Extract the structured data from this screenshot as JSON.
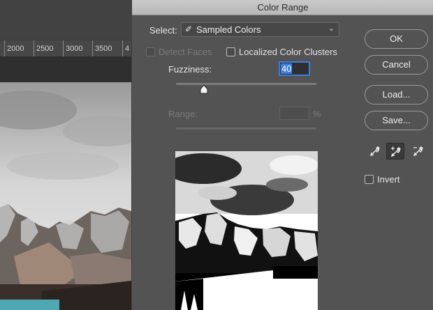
{
  "ruler": {
    "labels": [
      "2000",
      "2500",
      "3000",
      "3500",
      "4"
    ]
  },
  "dialog": {
    "title": "Color Range",
    "select_label": "Select:",
    "select_value": "Sampled Colors",
    "detect_faces_label": "Detect Faces",
    "localized_label": "Localized Color Clusters",
    "fuzziness_label": "Fuzziness:",
    "fuzziness_value": "40",
    "range_label": "Range:",
    "range_unit": "%",
    "fuzziness_level": 40,
    "buttons": {
      "ok": "OK",
      "cancel": "Cancel",
      "load": "Load...",
      "save": "Save..."
    },
    "invert_label": "Invert",
    "icons": [
      "eyedropper-icon",
      "eyedropper-plus-icon",
      "eyedropper-minus-icon"
    ]
  },
  "colors": {
    "accent": "#3d7fe0",
    "panel": "#535353"
  }
}
